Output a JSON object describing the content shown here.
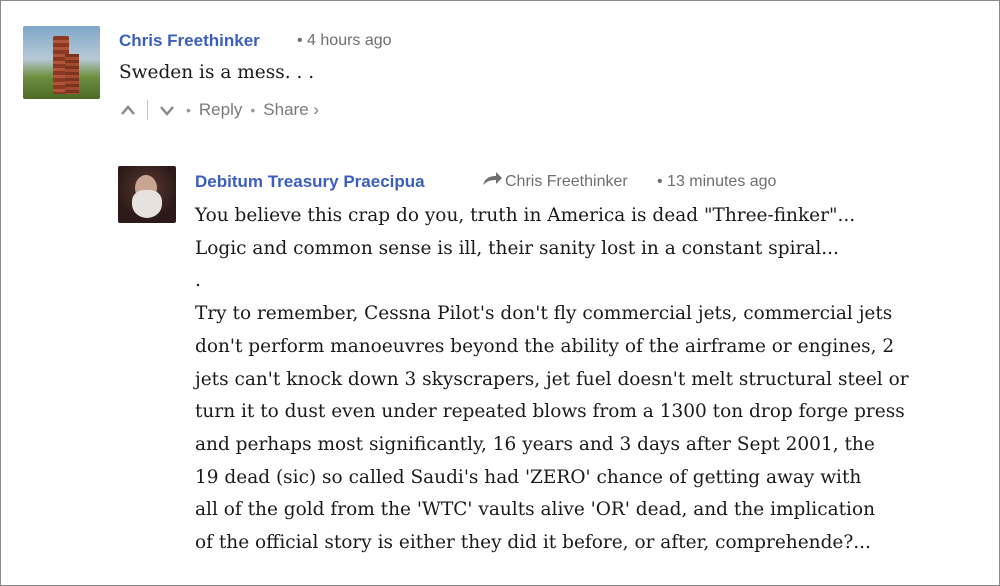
{
  "comments": [
    {
      "author": "Chris Freethinker",
      "timestamp": "• 4 hours ago",
      "text": "Sweden is a mess. . .",
      "actions": {
        "upvote_icon": "chevron-up-icon",
        "downvote_icon": "chevron-down-icon",
        "reply_label": "Reply",
        "share_label": "Share ›",
        "separator": "•"
      }
    },
    {
      "author": "Debitum Treasury Praecipua",
      "reply_to": "Chris Freethinker",
      "reply_icon": "reply-arrow-icon",
      "timestamp": "• 13 minutes ago",
      "text": "You believe this crap do you, truth in America is dead \"Three-finker\"...\nLogic and common sense is ill, their sanity lost in a constant spiral...\n.\nTry to remember, Cessna Pilot's don't fly commercial jets, commercial jets\ndon't perform manoeuvres beyond the ability of the airframe or engines, 2\njets can't knock down 3 skyscrapers, jet fuel doesn't melt structural steel or\nturn it to dust even under repeated blows from a 1300 ton drop forge press\nand perhaps most significantly, 16 years and 3 days after Sept 2001, the\n19 dead (sic) so called Saudi's had 'ZERO' chance of getting away with\nall of the gold from the 'WTC' vaults alive 'OR' dead, and the implication\nof the official story is either they did it before, or after, comprehende?..."
    }
  ],
  "colors": {
    "author": "#3b5fc0",
    "meta": "#6f6f6f",
    "body": "#1a1a1a",
    "border": "#8a8a8a"
  }
}
